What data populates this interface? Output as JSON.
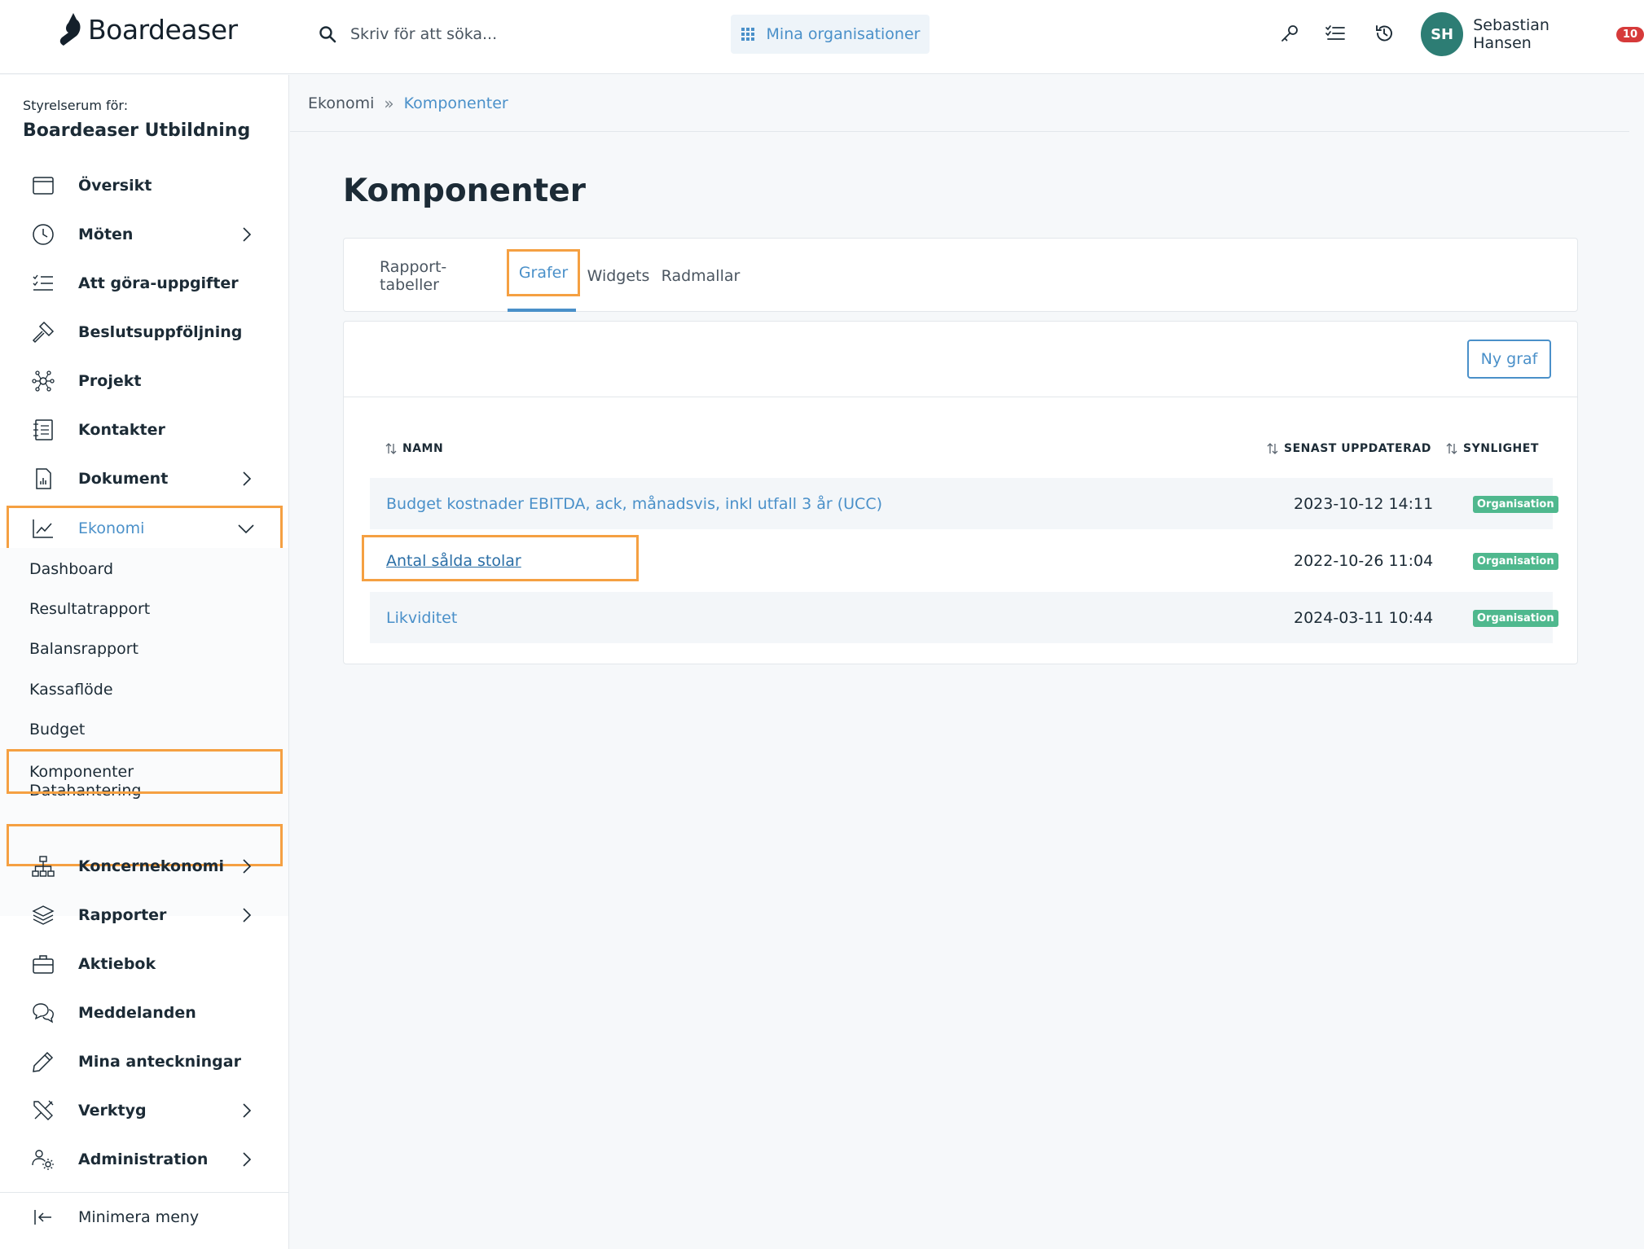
{
  "header": {
    "logo_text": "Boardeaser",
    "search_placeholder": "Skriv för att söka...",
    "orgs_button": "Mina organisationer",
    "user": {
      "initials": "SH",
      "name": "Sebastian Hansen",
      "notification_count": "10"
    },
    "icons": [
      "key-icon",
      "checklist-icon",
      "history-icon"
    ]
  },
  "sidebar": {
    "org_label": "Styrelserum för:",
    "org_name": "Boardeaser Utbildning",
    "items": [
      {
        "label": "Översikt",
        "icon": "calendar-icon",
        "chevron": false
      },
      {
        "label": "Möten",
        "icon": "clock-icon",
        "chevron": true
      },
      {
        "label": "Att göra-uppgifter",
        "icon": "checklist-icon",
        "chevron": false
      },
      {
        "label": "Beslutsuppföljning",
        "icon": "gavel-icon",
        "chevron": false
      },
      {
        "label": "Projekt",
        "icon": "network-icon",
        "chevron": false
      },
      {
        "label": "Kontakter",
        "icon": "address-book-icon",
        "chevron": false
      },
      {
        "label": "Dokument",
        "icon": "document-icon",
        "chevron": true
      },
      {
        "label": "Ekonomi",
        "icon": "chart-line-icon",
        "chevron": true,
        "expanded": true
      }
    ],
    "sub_items": [
      "Dashboard",
      "Resultatrapport",
      "Balansrapport",
      "Kassaflöde",
      "Budget",
      "Komponenter",
      "Datahantering"
    ],
    "items_after": [
      {
        "label": "Koncernekonomi",
        "icon": "org-chart-icon",
        "chevron": true
      },
      {
        "label": "Rapporter",
        "icon": "layers-icon",
        "chevron": true
      },
      {
        "label": "Aktiebok",
        "icon": "briefcase-icon",
        "chevron": false
      },
      {
        "label": "Meddelanden",
        "icon": "chat-icon",
        "chevron": false
      },
      {
        "label": "Mina anteckningar",
        "icon": "pencil-icon",
        "chevron": false
      },
      {
        "label": "Verktyg",
        "icon": "tools-icon",
        "chevron": true
      },
      {
        "label": "Administration",
        "icon": "users-gear-icon",
        "chevron": true
      }
    ],
    "collapse_label": "Minimera meny"
  },
  "breadcrumb": {
    "parent": "Ekonomi",
    "current": "Komponenter"
  },
  "page": {
    "title": "Komponenter",
    "tabs": [
      "Rapport-tabeller",
      "Grafer",
      "Widgets",
      "Radmallar"
    ],
    "active_tab": "Grafer",
    "new_button": "Ny graf",
    "columns": {
      "name": "NAMN",
      "updated": "SENAST UPPDATERAD",
      "visibility": "SYNLIGHET"
    },
    "rows": [
      {
        "name": "Budget kostnader EBITDA, ack, månadsvis, inkl utfall 3 år (UCC)",
        "updated": "2023-10-12 14:11",
        "visibility": "Organisation"
      },
      {
        "name": "Antal sålda stolar",
        "updated": "2022-10-26 11:04",
        "visibility": "Organisation"
      },
      {
        "name": "Likviditet",
        "updated": "2024-03-11 10:44",
        "visibility": "Organisation"
      }
    ]
  },
  "colors": {
    "accent": "#4a90c9",
    "highlight": "#f5a042",
    "badge_green": "#4fb88e",
    "avatar": "#2d7d74"
  }
}
